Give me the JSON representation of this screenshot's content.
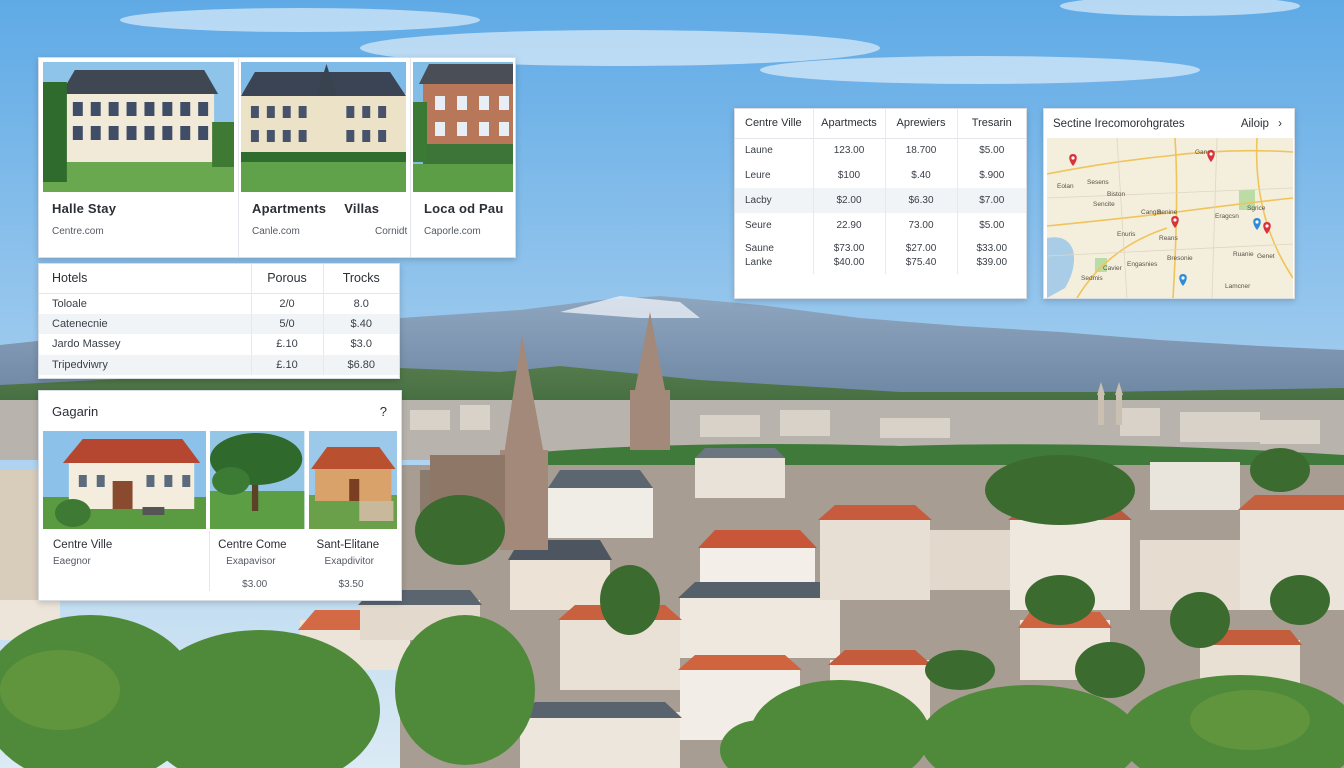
{
  "stays_card": {
    "items": [
      {
        "title_a": "Halle Stay",
        "title_b": "",
        "subtitle": "Centre.com"
      },
      {
        "title_a": "Apartments",
        "title_b": "Villas",
        "subtitle": "Canle.com"
      },
      {
        "title_a": "Loca od Pau",
        "title_b": "",
        "subtitle": "Caporle.com"
      }
    ],
    "subtitle_b": "Cornidt"
  },
  "hotels_card": {
    "headers": [
      "Hotels",
      "Porous",
      "Trocks"
    ],
    "rows": [
      [
        "Toloale",
        "2/0",
        "8.0"
      ],
      [
        "Catenecnie",
        "5/0",
        "$.40"
      ],
      [
        "Jardo Massey",
        "£.10",
        "$3.0"
      ],
      [
        "Tripedviwry",
        "£.10",
        "$6.80"
      ]
    ]
  },
  "gagarin_card": {
    "title": "Gagarin",
    "action": "?",
    "items": [
      {
        "title": "Centre Ville",
        "subtitle": "Eaegnor",
        "price": ""
      },
      {
        "title": "Centre Come",
        "subtitle": "Exapavisor",
        "price": "$3.00"
      },
      {
        "title": "Sant-Elitane",
        "subtitle": "Exapdivitor",
        "price": "$3.50"
      }
    ]
  },
  "centre_card": {
    "headers": [
      "Centre Ville",
      "Apartmects",
      "Aprewiers",
      "Tresarin"
    ],
    "rows": [
      [
        "Laune",
        "123.00",
        "18.700",
        "$5.00"
      ],
      [
        "Leure",
        "$100",
        "$.40",
        "$.900"
      ],
      [
        "Lacby",
        "$2.00",
        "$6.30",
        "$7.00"
      ],
      [
        "Seure",
        "22.90",
        "73.00",
        "$5.00"
      ]
    ],
    "last_row": {
      "names": [
        "Saune",
        "Lanke"
      ],
      "col1": [
        "$73.00",
        "$40.00"
      ],
      "col2": [
        "$27.00",
        "$75.40"
      ],
      "col3": [
        "$33.00",
        "$39.00"
      ]
    }
  },
  "map_card": {
    "title": "Sectine Irecomorohgrates",
    "action": "Ailoip",
    "chevron": "›",
    "labels": [
      "Sesens",
      "Biston",
      "Sencite",
      "Cangia",
      "Senine",
      "Eragcsn",
      "Enuris",
      "Reans",
      "Bresonie",
      "Cavier",
      "Engasnies",
      "Genet",
      "Lamcner",
      "Sedmis",
      "Sgrice",
      "Ganet",
      "Ruanie",
      "Eolan"
    ],
    "pin_colors": {
      "red": "#d8323a",
      "blue": "#2f8bd6"
    }
  },
  "colors": {
    "sky_top": "#6fb2e8",
    "sky_bottom": "#cfe6f6",
    "card_bg": "#ffffff",
    "text": "#2b2f36",
    "zebra": "#f1f4f7"
  }
}
